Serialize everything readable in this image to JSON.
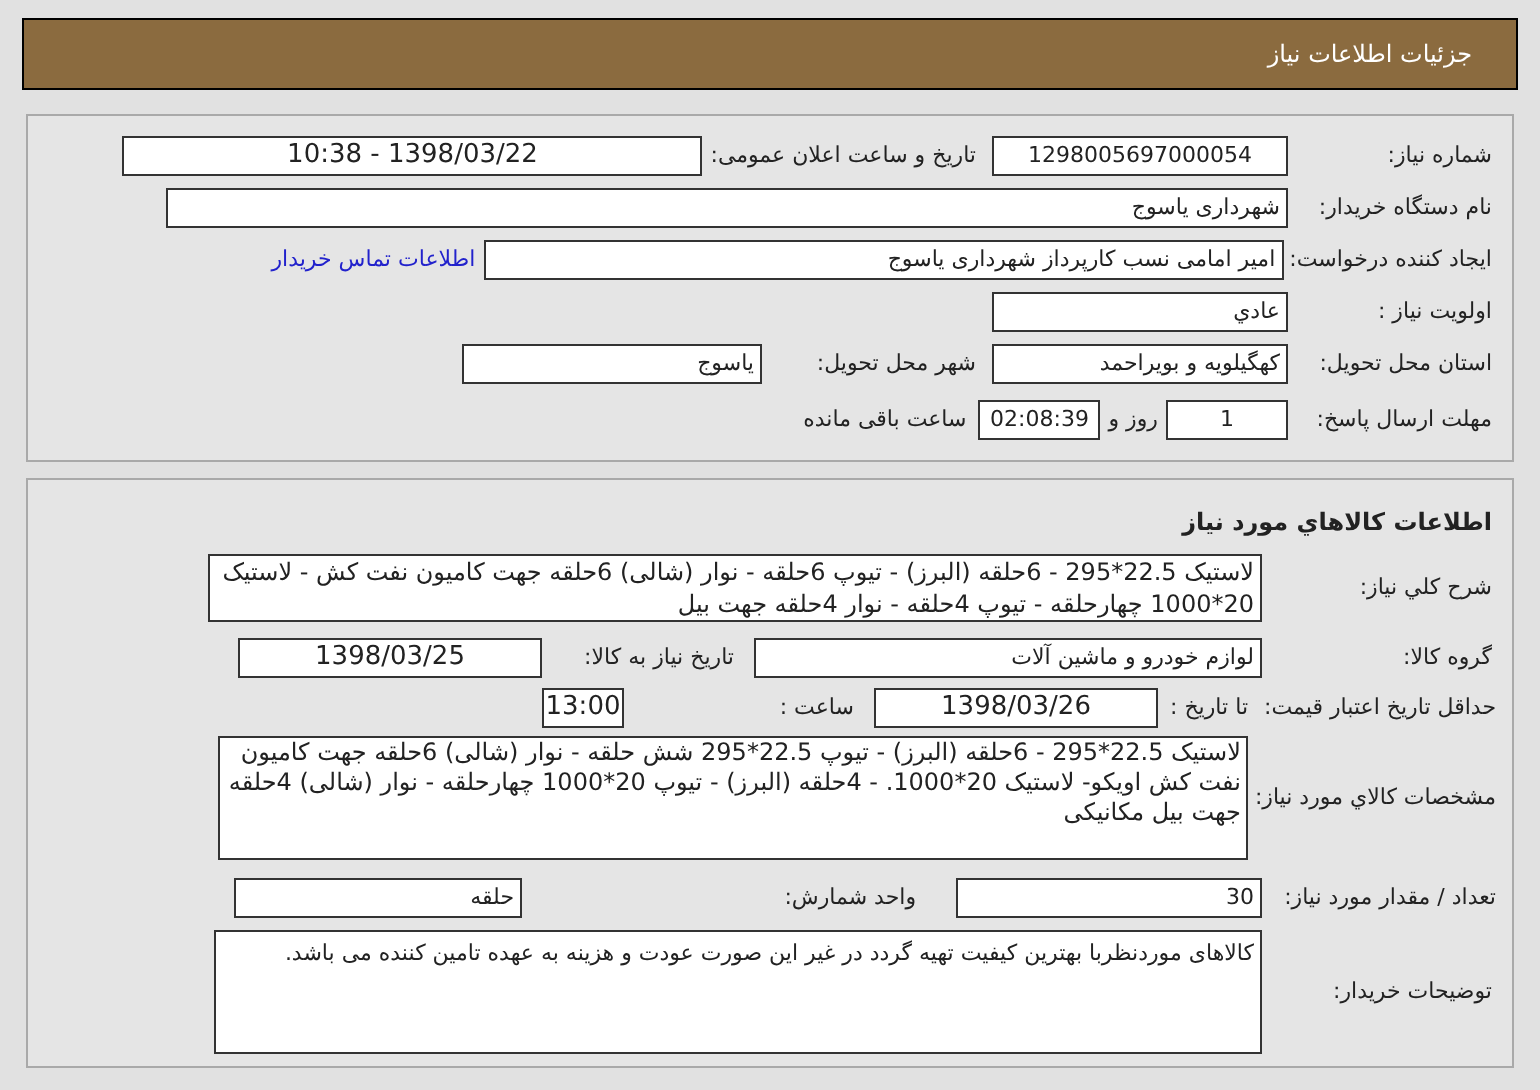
{
  "header_title": "جزئیات اطلاعات نیاز",
  "need": {
    "need_number_label": "شماره نیاز:",
    "need_number": "1298005697000054",
    "announce_label": "تاریخ و ساعت اعلان عمومی:",
    "announce_value": "1398/03/22 - 10:38",
    "buyer_label": "نام دستگاه خریدار:",
    "buyer": "شهرداری یاسوج",
    "creator_label": "ایجاد کننده درخواست:",
    "creator": "امیر امامی نسب کارپرداز شهرداری یاسوج",
    "contact_link": "اطلاعات تماس خریدار",
    "priority_label": "اولویت نیاز :",
    "priority": "عادي",
    "province_label": "استان محل تحویل:",
    "province": "کهگیلویه و بویراحمد",
    "city_label": "شهر محل تحویل:",
    "city": "یاسوج",
    "deadline_label": "مهلت ارسال پاسخ:",
    "days": "1",
    "days_label": "روز و",
    "time_left": "02:08:39",
    "time_left_label": "ساعت باقی مانده"
  },
  "goods": {
    "title": "اطلاعات کالاهاي مورد نياز",
    "summary_label": "شرح کلي نياز:",
    "summary": "لاستیک 22.5*295  - 6حلقه  (البرز) - تیوپ  6حلقه - نوار (شالی) 6حلقه جهت کامیون نفت کش - لاستیک 20*1000 چهارحلقه  - تیوپ  4حلقه - نوار 4حلقه جهت بیل",
    "group_label": "گروه کالا:",
    "group": "لوازم خودرو و ماشین آلات",
    "need_date_label": "تاریخ نیاز به کالا:",
    "need_date": "1398/03/25",
    "validity_label": "حداقل تاریخ اعتبار قیمت:",
    "until_label": "تا تاریخ :",
    "until_date": "1398/03/26",
    "hour_label": "ساعت :",
    "hour": "13:00",
    "specs_label": "مشخصات کالاي مورد نياز:",
    "specs": "لاستیک 22.5*295  - 6حلقه  (البرز) - تیوپ  22.5*295 شش حلقه - نوار (شالی) 6حلقه جهت کامیون نفت کش اویکو- لاستیک 20*1000. - 4حلقه  (البرز) - تیوپ  20*1000 چهارحلقه - نوار (شالی) 4حلقه جهت بیل مکانیکی",
    "quantity_label": "تعداد / مقدار مورد نیاز:",
    "quantity": "30",
    "unit_label": "واحد شمارش:",
    "unit": "حلقه",
    "notes_label": "توضیحات خریدار:",
    "notes": "کالاهای موردنظربا بهترین کیفیت تهیه گردد در غیر این صورت عودت و هزینه به عهده تامین کننده می باشد."
  }
}
